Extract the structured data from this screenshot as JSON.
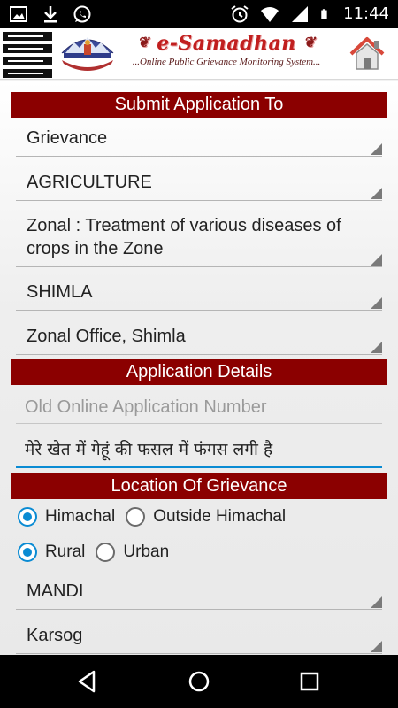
{
  "status_bar": {
    "time": "11:44",
    "left_icons": [
      "image-icon",
      "download-icon",
      "whatsapp-icon"
    ],
    "right_icons": [
      "alarm-icon",
      "wifi-icon",
      "signal-icon",
      "battery-icon"
    ]
  },
  "header": {
    "brand_title": "e-Samadhan",
    "brand_subtitle": "...Online Public Grievance Monitoring System..."
  },
  "sections": {
    "submit_to": "Submit Application To",
    "application_details": "Application Details",
    "location": "Location Of Grievance"
  },
  "submit_to": {
    "type": "Grievance",
    "department": "AGRICULTURE",
    "subject": "Zonal : Treatment of various diseases of crops in the Zone",
    "district": "SHIMLA",
    "office": "Zonal Office, Shimla"
  },
  "application_details": {
    "old_number_placeholder": "Old Online Application Number",
    "description": "मेरे खेत में गेहूं की फसल में फंगस लगी है"
  },
  "location": {
    "region_options": [
      "Himachal",
      "Outside Himachal"
    ],
    "region_selected": "Himachal",
    "area_options": [
      "Rural",
      "Urban"
    ],
    "area_selected": "Rural",
    "district": "MANDI",
    "block": "Karsog"
  },
  "colors": {
    "section_header": "#8b0000",
    "accent": "#0a8bd3",
    "brand_red": "#c11f1f"
  }
}
